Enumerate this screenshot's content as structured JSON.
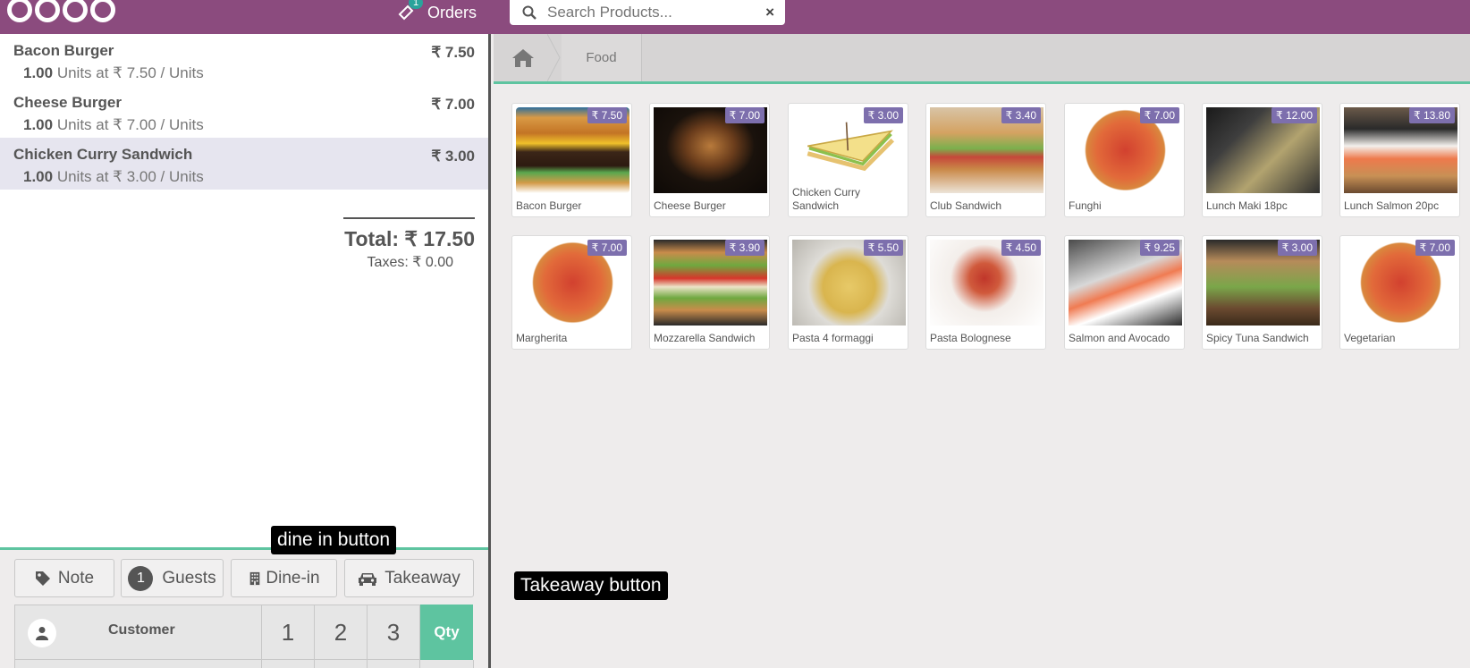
{
  "topbar": {
    "orders_label": "Orders",
    "orders_count": "1",
    "search_placeholder": "Search Products...",
    "clear_icon": "×"
  },
  "order": {
    "lines": [
      {
        "name": "Bacon Burger",
        "price": "₹ 7.50",
        "qty": "1.00",
        "info": " Units at ₹ 7.50 / Units"
      },
      {
        "name": "Cheese Burger",
        "price": "₹ 7.00",
        "qty": "1.00",
        "info": " Units at ₹ 7.00 / Units"
      },
      {
        "name": "Chicken Curry Sandwich",
        "price": "₹ 3.00",
        "qty": "1.00",
        "info": " Units at ₹ 3.00 / Units"
      }
    ],
    "total": "Total: ₹ 17.50",
    "taxes": "Taxes: ₹ 0.00"
  },
  "controls": {
    "note": "Note",
    "guests_count": "1",
    "guests": "Guests",
    "dine_in": "Dine-in",
    "takeaway": "Takeaway",
    "customer": "Customer",
    "num1": "1",
    "num2": "2",
    "num3": "3",
    "qty": "Qty"
  },
  "breadcrumb": {
    "category": "Food"
  },
  "products": [
    {
      "name": "Bacon Burger",
      "price": "₹ 7.50"
    },
    {
      "name": "Cheese Burger",
      "price": "₹ 7.00"
    },
    {
      "name": "Chicken Curry Sandwich",
      "price": "₹ 3.00"
    },
    {
      "name": "Club Sandwich",
      "price": "₹ 3.40"
    },
    {
      "name": "Funghi",
      "price": "₹ 7.00"
    },
    {
      "name": "Lunch Maki 18pc",
      "price": "₹ 12.00"
    },
    {
      "name": "Lunch Salmon 20pc",
      "price": "₹ 13.80"
    },
    {
      "name": "Margherita",
      "price": "₹ 7.00"
    },
    {
      "name": "Mozzarella Sandwich",
      "price": "₹ 3.90"
    },
    {
      "name": "Pasta 4 formaggi",
      "price": "₹ 5.50"
    },
    {
      "name": "Pasta Bolognese",
      "price": "₹ 4.50"
    },
    {
      "name": "Salmon and Avocado",
      "price": "₹ 9.25"
    },
    {
      "name": "Spicy Tuna Sandwich",
      "price": "₹ 3.00"
    },
    {
      "name": "Vegetarian",
      "price": "₹ 7.00"
    }
  ],
  "annotations": {
    "dine_in": "dine in button",
    "takeaway": "Takeaway button"
  }
}
